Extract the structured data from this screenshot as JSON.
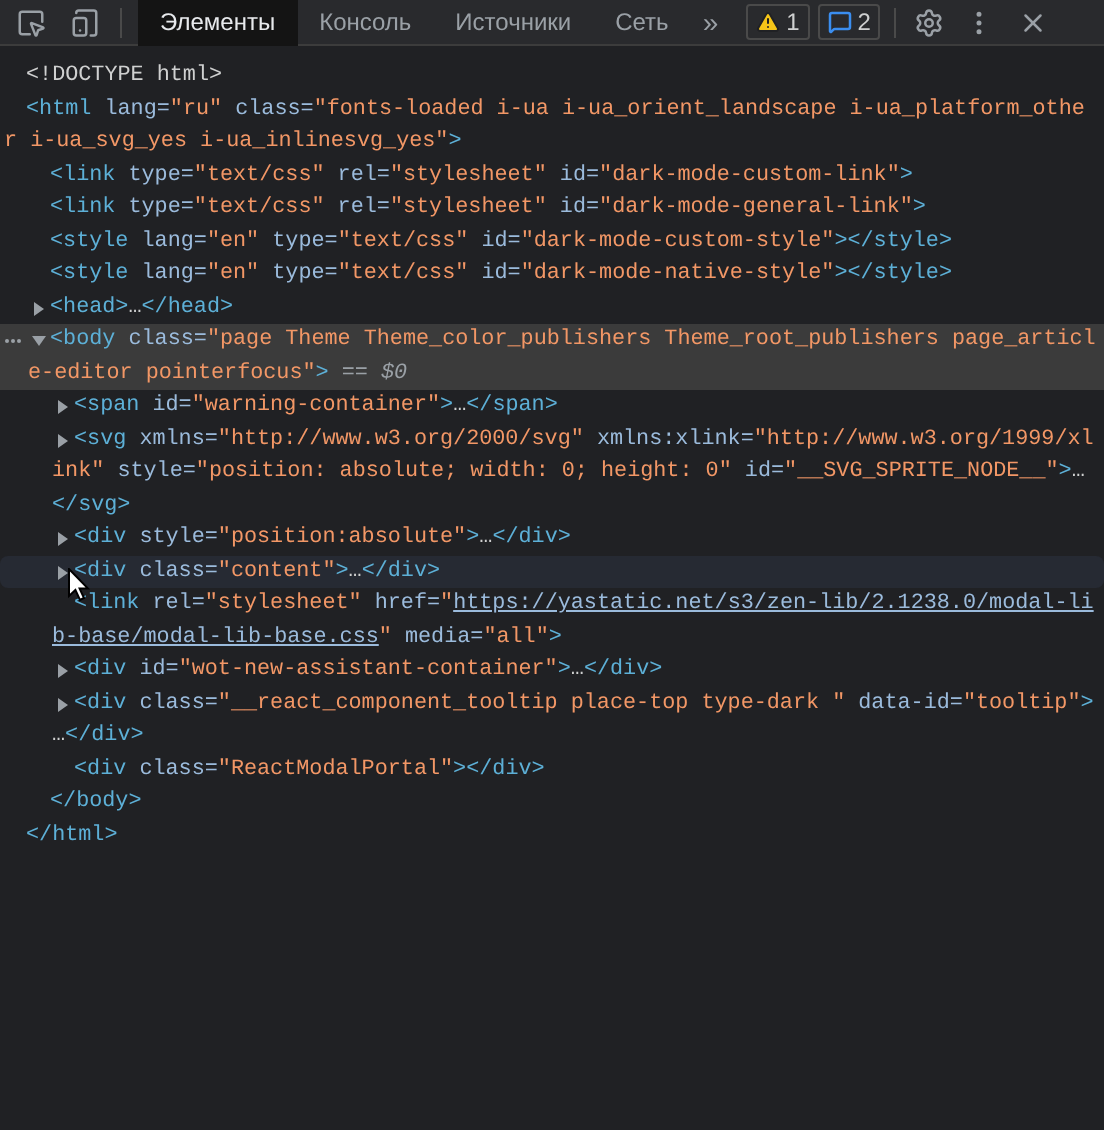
{
  "toolbar": {
    "tabs": [
      {
        "label": "Элементы",
        "selected": true
      },
      {
        "label": "Консоль",
        "selected": false
      },
      {
        "label": "Источники",
        "selected": false
      },
      {
        "label": "Сеть",
        "selected": false
      }
    ],
    "more": "»",
    "badges": [
      {
        "kind": "warning",
        "count": "1"
      },
      {
        "kind": "message",
        "count": "2"
      }
    ]
  },
  "nodes": [
    {
      "lines": [
        {
          "tokens": [
            {
              "kind": "text",
              "text": "<!DOCTYPE html>"
            }
          ]
        }
      ]
    },
    {
      "lines": [
        {
          "tokens": [
            {
              "kind": "tag",
              "text": "<html"
            },
            {
              "kind": "attr",
              "text": " lang="
            },
            {
              "kind": "value",
              "text": "\"ru\""
            },
            {
              "kind": "attr",
              "text": " class="
            },
            {
              "kind": "value",
              "text": "\"fonts-loaded i-ua i-ua_orient_landscape i-ua_platform_othe"
            }
          ]
        },
        {
          "tokens": [
            {
              "kind": "value",
              "text": "r i-ua_svg_yes i-ua_inlinesvg_yes\""
            },
            {
              "kind": "tag",
              "text": ">"
            }
          ]
        }
      ],
      "closing": {
        "tokens": [
          {
            "kind": "tag",
            "text": "</html>"
          }
        ]
      },
      "children": [
        {
          "lines": [
            {
              "tokens": [
                {
                  "kind": "tag",
                  "text": "<link"
                },
                {
                  "kind": "attr",
                  "text": " type="
                },
                {
                  "kind": "value",
                  "text": "\"text/css\""
                },
                {
                  "kind": "attr",
                  "text": " rel="
                },
                {
                  "kind": "value",
                  "text": "\"stylesheet\""
                },
                {
                  "kind": "attr",
                  "text": " id="
                },
                {
                  "kind": "value",
                  "text": "\"dark-mode-custom-link\""
                },
                {
                  "kind": "tag",
                  "text": ">"
                }
              ]
            }
          ]
        },
        {
          "lines": [
            {
              "tokens": [
                {
                  "kind": "tag",
                  "text": "<link"
                },
                {
                  "kind": "attr",
                  "text": " type="
                },
                {
                  "kind": "value",
                  "text": "\"text/css\""
                },
                {
                  "kind": "attr",
                  "text": " rel="
                },
                {
                  "kind": "value",
                  "text": "\"stylesheet\""
                },
                {
                  "kind": "attr",
                  "text": " id="
                },
                {
                  "kind": "value",
                  "text": "\"dark-mode-general-link\""
                },
                {
                  "kind": "tag",
                  "text": ">"
                }
              ]
            }
          ]
        },
        {
          "lines": [
            {
              "tokens": [
                {
                  "kind": "tag",
                  "text": "<style"
                },
                {
                  "kind": "attr",
                  "text": " lang="
                },
                {
                  "kind": "value",
                  "text": "\"en\""
                },
                {
                  "kind": "attr",
                  "text": " type="
                },
                {
                  "kind": "value",
                  "text": "\"text/css\""
                },
                {
                  "kind": "attr",
                  "text": " id="
                },
                {
                  "kind": "value",
                  "text": "\"dark-mode-custom-style\""
                },
                {
                  "kind": "tag",
                  "text": "></style>"
                }
              ]
            }
          ]
        },
        {
          "lines": [
            {
              "tokens": [
                {
                  "kind": "tag",
                  "text": "<style"
                },
                {
                  "kind": "attr",
                  "text": " lang="
                },
                {
                  "kind": "value",
                  "text": "\"en\""
                },
                {
                  "kind": "attr",
                  "text": " type="
                },
                {
                  "kind": "value",
                  "text": "\"text/css\""
                },
                {
                  "kind": "attr",
                  "text": " id="
                },
                {
                  "kind": "value",
                  "text": "\"dark-mode-native-style\""
                },
                {
                  "kind": "tag",
                  "text": "></style>"
                }
              ]
            }
          ]
        },
        {
          "expanded": false,
          "lines": [
            {
              "tokens": [
                {
                  "kind": "tag",
                  "text": "<head>"
                },
                {
                  "kind": "text",
                  "text": "…"
                },
                {
                  "kind": "tag",
                  "text": "</head>"
                }
              ]
            }
          ]
        },
        {
          "expanded": true,
          "selected": true,
          "lines": [
            {
              "tokens": [
                {
                  "kind": "tag",
                  "text": "<body"
                },
                {
                  "kind": "attr",
                  "text": " class="
                },
                {
                  "kind": "value",
                  "text": "\"page Theme Theme_color_publishers Theme_root_publishers page_articl"
                }
              ]
            },
            {
              "tokens": [
                {
                  "kind": "value",
                  "text": "e-editor pointerfocus\""
                },
                {
                  "kind": "tag",
                  "text": ">"
                },
                {
                  "kind": "marker",
                  "text": " == $0"
                }
              ]
            }
          ],
          "closing": {
            "tokens": [
              {
                "kind": "tag",
                "text": "</body>"
              }
            ]
          },
          "children": [
            {
              "expanded": false,
              "lines": [
                {
                  "tokens": [
                    {
                      "kind": "tag",
                      "text": "<span"
                    },
                    {
                      "kind": "attr",
                      "text": " id="
                    },
                    {
                      "kind": "value",
                      "text": "\"warning-container\""
                    },
                    {
                      "kind": "tag",
                      "text": ">"
                    },
                    {
                      "kind": "text",
                      "text": "…"
                    },
                    {
                      "kind": "tag",
                      "text": "</span>"
                    }
                  ]
                }
              ]
            },
            {
              "expanded": false,
              "lines": [
                {
                  "tokens": [
                    {
                      "kind": "tag",
                      "text": "<svg"
                    },
                    {
                      "kind": "attr",
                      "text": " xmlns="
                    },
                    {
                      "kind": "value",
                      "text": "\"http://www.w3.org/2000/svg\""
                    },
                    {
                      "kind": "attr",
                      "text": " xmlns:xlink="
                    },
                    {
                      "kind": "value",
                      "text": "\"http://www.w3.org/1999/xl"
                    }
                  ]
                },
                {
                  "tokens": [
                    {
                      "kind": "value",
                      "text": "ink\""
                    },
                    {
                      "kind": "attr",
                      "text": " style="
                    },
                    {
                      "kind": "value",
                      "text": "\"position: absolute; width: 0; height: 0\""
                    },
                    {
                      "kind": "attr",
                      "text": " id="
                    },
                    {
                      "kind": "value",
                      "text": "\"__SVG_SPRITE_NODE__\""
                    },
                    {
                      "kind": "tag",
                      "text": ">"
                    },
                    {
                      "kind": "text",
                      "text": "…"
                    }
                  ]
                },
                {
                  "tokens": [
                    {
                      "kind": "tag",
                      "text": "</svg>"
                    }
                  ]
                }
              ]
            },
            {
              "expanded": false,
              "lines": [
                {
                  "tokens": [
                    {
                      "kind": "tag",
                      "text": "<div"
                    },
                    {
                      "kind": "attr",
                      "text": " style="
                    },
                    {
                      "kind": "value",
                      "text": "\"position:absolute\""
                    },
                    {
                      "kind": "tag",
                      "text": ">"
                    },
                    {
                      "kind": "text",
                      "text": "…"
                    },
                    {
                      "kind": "tag",
                      "text": "</div>"
                    }
                  ]
                }
              ]
            },
            {
              "expanded": false,
              "hovered": true,
              "lines": [
                {
                  "tokens": [
                    {
                      "kind": "tag",
                      "text": "<div"
                    },
                    {
                      "kind": "attr",
                      "text": " class="
                    },
                    {
                      "kind": "value",
                      "text": "\"content\""
                    },
                    {
                      "kind": "tag",
                      "text": ">"
                    },
                    {
                      "kind": "text",
                      "text": "…"
                    },
                    {
                      "kind": "tag",
                      "text": "</div>"
                    }
                  ]
                }
              ]
            },
            {
              "lines": [
                {
                  "tokens": [
                    {
                      "kind": "tag",
                      "text": "<link"
                    },
                    {
                      "kind": "attr",
                      "text": " rel="
                    },
                    {
                      "kind": "value",
                      "text": "\"stylesheet\""
                    },
                    {
                      "kind": "attr",
                      "text": " href="
                    },
                    {
                      "kind": "value",
                      "text": "\""
                    },
                    {
                      "kind": "url",
                      "text": "https://yastatic.net/s3/zen-lib/2.1238.0/modal-li"
                    }
                  ]
                },
                {
                  "tokens": [
                    {
                      "kind": "url",
                      "text": "b-base/modal-lib-base.css"
                    },
                    {
                      "kind": "value",
                      "text": "\""
                    },
                    {
                      "kind": "attr",
                      "text": " media="
                    },
                    {
                      "kind": "value",
                      "text": "\"all\""
                    },
                    {
                      "kind": "tag",
                      "text": ">"
                    }
                  ]
                }
              ]
            },
            {
              "expanded": false,
              "lines": [
                {
                  "tokens": [
                    {
                      "kind": "tag",
                      "text": "<div"
                    },
                    {
                      "kind": "attr",
                      "text": " id="
                    },
                    {
                      "kind": "value",
                      "text": "\"wot-new-assistant-container\""
                    },
                    {
                      "kind": "tag",
                      "text": ">"
                    },
                    {
                      "kind": "text",
                      "text": "…"
                    },
                    {
                      "kind": "tag",
                      "text": "</div>"
                    }
                  ]
                }
              ]
            },
            {
              "expanded": false,
              "lines": [
                {
                  "tokens": [
                    {
                      "kind": "tag",
                      "text": "<div"
                    },
                    {
                      "kind": "attr",
                      "text": " class="
                    },
                    {
                      "kind": "value",
                      "text": "\"__react_component_tooltip place-top type-dark \""
                    },
                    {
                      "kind": "attr",
                      "text": " data-id="
                    },
                    {
                      "kind": "value",
                      "text": "\"tooltip\""
                    },
                    {
                      "kind": "tag",
                      "text": ">"
                    }
                  ]
                },
                {
                  "tokens": [
                    {
                      "kind": "text",
                      "text": "…"
                    },
                    {
                      "kind": "tag",
                      "text": "</div>"
                    }
                  ]
                }
              ]
            },
            {
              "lines": [
                {
                  "tokens": [
                    {
                      "kind": "tag",
                      "text": "<div"
                    },
                    {
                      "kind": "attr",
                      "text": " class="
                    },
                    {
                      "kind": "value",
                      "text": "\"ReactModalPortal\""
                    },
                    {
                      "kind": "tag",
                      "text": "></div>"
                    }
                  ]
                }
              ]
            }
          ]
        }
      ]
    }
  ]
}
